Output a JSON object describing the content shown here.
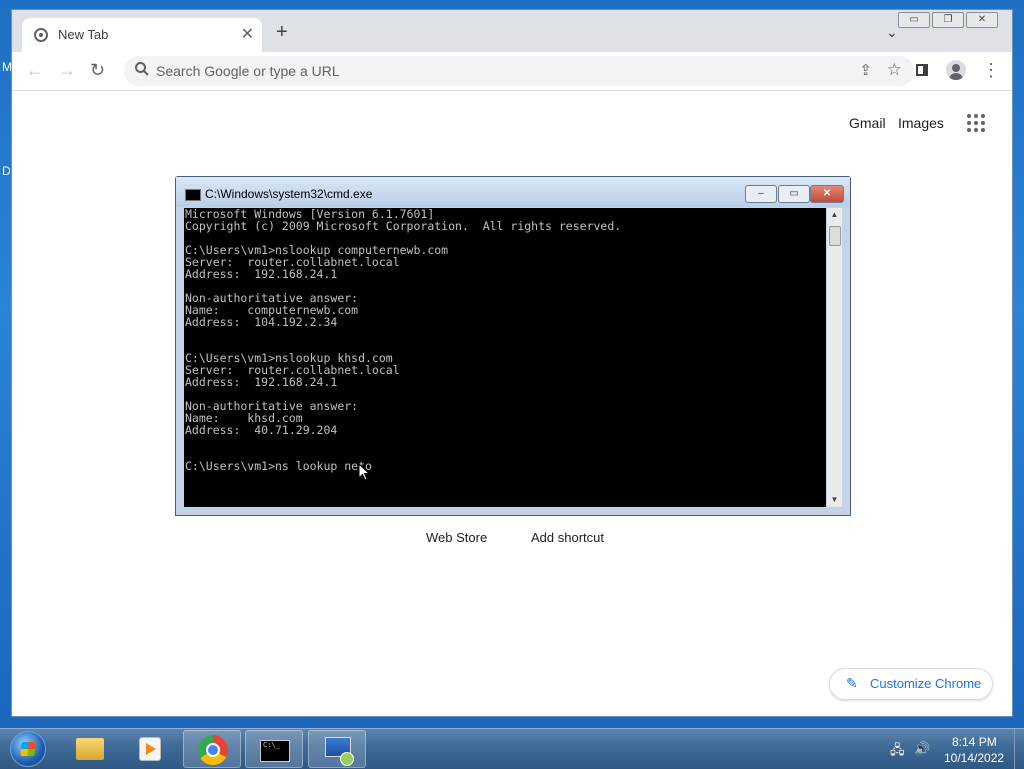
{
  "desktop": {
    "fragment_top": "M",
    "fragment_bottom": "D"
  },
  "chrome": {
    "tab_title": "New Tab",
    "tab_close": "✕",
    "new_tab": "+",
    "tab_search": "⌄",
    "window_min": "▭",
    "window_restore": "❐",
    "window_close": "✕",
    "nav": {
      "back": "←",
      "forward": "→",
      "reload": "↻"
    },
    "omnibox_text": "Search Google or type a URL",
    "omnibox_search_icon": "search-icon",
    "share": "⇪",
    "bookmark": "☆",
    "menu": "⋮",
    "ntp": {
      "gmail": "Gmail",
      "images": "Images",
      "web_store": "Web Store",
      "add_shortcut": "Add shortcut",
      "customize": "Customize Chrome",
      "customize_icon": "✎"
    }
  },
  "cmd": {
    "title": "C:\\Windows\\system32\\cmd.exe",
    "min": "–",
    "max": "▭",
    "close": "✕",
    "console": "Microsoft Windows [Version 6.1.7601]\nCopyright (c) 2009 Microsoft Corporation.  All rights reserved.\n\nC:\\Users\\vm1>nslookup computernewb.com\nServer:  router.collabnet.local\nAddress:  192.168.24.1\n\nNon-authoritative answer:\nName:    computernewb.com\nAddress:  104.192.2.34\n\n\nC:\\Users\\vm1>nslookup khsd.com\nServer:  router.collabnet.local\nAddress:  192.168.24.1\n\nNon-authoritative answer:\nName:    khsd.com\nAddress:  40.71.29.204\n\n\nC:\\Users\\vm1>ns lookup neto",
    "scroll_up": "▲",
    "scroll_down": "▼"
  },
  "taskbar": {
    "cmd_icon_text": "C:\\_",
    "tray_network": "🖧",
    "tray_volume": "🔊",
    "time": "8:14 PM",
    "date": "10/14/2022"
  },
  "colors": {
    "chrome_accent": "#1a73e8",
    "console_bg": "#000000",
    "console_text": "#c0c0c0",
    "taskbar": "#3f6a96"
  }
}
